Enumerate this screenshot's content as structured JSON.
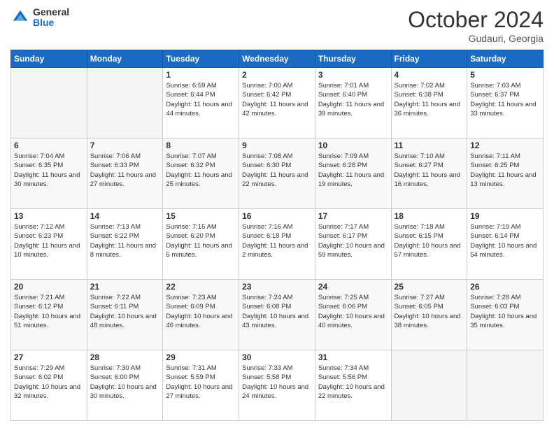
{
  "header": {
    "logo": {
      "general": "General",
      "blue": "Blue"
    },
    "title": "October 2024",
    "location": "Gudauri, Georgia"
  },
  "weekdays": [
    "Sunday",
    "Monday",
    "Tuesday",
    "Wednesday",
    "Thursday",
    "Friday",
    "Saturday"
  ],
  "weeks": [
    [
      {
        "day": "",
        "empty": true
      },
      {
        "day": "",
        "empty": true
      },
      {
        "day": "1",
        "sunrise": "Sunrise: 6:59 AM",
        "sunset": "Sunset: 6:44 PM",
        "daylight": "Daylight: 11 hours and 44 minutes."
      },
      {
        "day": "2",
        "sunrise": "Sunrise: 7:00 AM",
        "sunset": "Sunset: 6:42 PM",
        "daylight": "Daylight: 11 hours and 42 minutes."
      },
      {
        "day": "3",
        "sunrise": "Sunrise: 7:01 AM",
        "sunset": "Sunset: 6:40 PM",
        "daylight": "Daylight: 11 hours and 39 minutes."
      },
      {
        "day": "4",
        "sunrise": "Sunrise: 7:02 AM",
        "sunset": "Sunset: 6:38 PM",
        "daylight": "Daylight: 11 hours and 36 minutes."
      },
      {
        "day": "5",
        "sunrise": "Sunrise: 7:03 AM",
        "sunset": "Sunset: 6:37 PM",
        "daylight": "Daylight: 11 hours and 33 minutes."
      }
    ],
    [
      {
        "day": "6",
        "sunrise": "Sunrise: 7:04 AM",
        "sunset": "Sunset: 6:35 PM",
        "daylight": "Daylight: 11 hours and 30 minutes."
      },
      {
        "day": "7",
        "sunrise": "Sunrise: 7:06 AM",
        "sunset": "Sunset: 6:33 PM",
        "daylight": "Daylight: 11 hours and 27 minutes."
      },
      {
        "day": "8",
        "sunrise": "Sunrise: 7:07 AM",
        "sunset": "Sunset: 6:32 PM",
        "daylight": "Daylight: 11 hours and 25 minutes."
      },
      {
        "day": "9",
        "sunrise": "Sunrise: 7:08 AM",
        "sunset": "Sunset: 6:30 PM",
        "daylight": "Daylight: 11 hours and 22 minutes."
      },
      {
        "day": "10",
        "sunrise": "Sunrise: 7:09 AM",
        "sunset": "Sunset: 6:28 PM",
        "daylight": "Daylight: 11 hours and 19 minutes."
      },
      {
        "day": "11",
        "sunrise": "Sunrise: 7:10 AM",
        "sunset": "Sunset: 6:27 PM",
        "daylight": "Daylight: 11 hours and 16 minutes."
      },
      {
        "day": "12",
        "sunrise": "Sunrise: 7:11 AM",
        "sunset": "Sunset: 6:25 PM",
        "daylight": "Daylight: 11 hours and 13 minutes."
      }
    ],
    [
      {
        "day": "13",
        "sunrise": "Sunrise: 7:12 AM",
        "sunset": "Sunset: 6:23 PM",
        "daylight": "Daylight: 11 hours and 10 minutes."
      },
      {
        "day": "14",
        "sunrise": "Sunrise: 7:13 AM",
        "sunset": "Sunset: 6:22 PM",
        "daylight": "Daylight: 11 hours and 8 minutes."
      },
      {
        "day": "15",
        "sunrise": "Sunrise: 7:15 AM",
        "sunset": "Sunset: 6:20 PM",
        "daylight": "Daylight: 11 hours and 5 minutes."
      },
      {
        "day": "16",
        "sunrise": "Sunrise: 7:16 AM",
        "sunset": "Sunset: 6:18 PM",
        "daylight": "Daylight: 11 hours and 2 minutes."
      },
      {
        "day": "17",
        "sunrise": "Sunrise: 7:17 AM",
        "sunset": "Sunset: 6:17 PM",
        "daylight": "Daylight: 10 hours and 59 minutes."
      },
      {
        "day": "18",
        "sunrise": "Sunrise: 7:18 AM",
        "sunset": "Sunset: 6:15 PM",
        "daylight": "Daylight: 10 hours and 57 minutes."
      },
      {
        "day": "19",
        "sunrise": "Sunrise: 7:19 AM",
        "sunset": "Sunset: 6:14 PM",
        "daylight": "Daylight: 10 hours and 54 minutes."
      }
    ],
    [
      {
        "day": "20",
        "sunrise": "Sunrise: 7:21 AM",
        "sunset": "Sunset: 6:12 PM",
        "daylight": "Daylight: 10 hours and 51 minutes."
      },
      {
        "day": "21",
        "sunrise": "Sunrise: 7:22 AM",
        "sunset": "Sunset: 6:11 PM",
        "daylight": "Daylight: 10 hours and 48 minutes."
      },
      {
        "day": "22",
        "sunrise": "Sunrise: 7:23 AM",
        "sunset": "Sunset: 6:09 PM",
        "daylight": "Daylight: 10 hours and 46 minutes."
      },
      {
        "day": "23",
        "sunrise": "Sunrise: 7:24 AM",
        "sunset": "Sunset: 6:08 PM",
        "daylight": "Daylight: 10 hours and 43 minutes."
      },
      {
        "day": "24",
        "sunrise": "Sunrise: 7:25 AM",
        "sunset": "Sunset: 6:06 PM",
        "daylight": "Daylight: 10 hours and 40 minutes."
      },
      {
        "day": "25",
        "sunrise": "Sunrise: 7:27 AM",
        "sunset": "Sunset: 6:05 PM",
        "daylight": "Daylight: 10 hours and 38 minutes."
      },
      {
        "day": "26",
        "sunrise": "Sunrise: 7:28 AM",
        "sunset": "Sunset: 6:03 PM",
        "daylight": "Daylight: 10 hours and 35 minutes."
      }
    ],
    [
      {
        "day": "27",
        "sunrise": "Sunrise: 7:29 AM",
        "sunset": "Sunset: 6:02 PM",
        "daylight": "Daylight: 10 hours and 32 minutes."
      },
      {
        "day": "28",
        "sunrise": "Sunrise: 7:30 AM",
        "sunset": "Sunset: 6:00 PM",
        "daylight": "Daylight: 10 hours and 30 minutes."
      },
      {
        "day": "29",
        "sunrise": "Sunrise: 7:31 AM",
        "sunset": "Sunset: 5:59 PM",
        "daylight": "Daylight: 10 hours and 27 minutes."
      },
      {
        "day": "30",
        "sunrise": "Sunrise: 7:33 AM",
        "sunset": "Sunset: 5:58 PM",
        "daylight": "Daylight: 10 hours and 24 minutes."
      },
      {
        "day": "31",
        "sunrise": "Sunrise: 7:34 AM",
        "sunset": "Sunset: 5:56 PM",
        "daylight": "Daylight: 10 hours and 22 minutes."
      },
      {
        "day": "",
        "empty": true
      },
      {
        "day": "",
        "empty": true
      }
    ]
  ]
}
